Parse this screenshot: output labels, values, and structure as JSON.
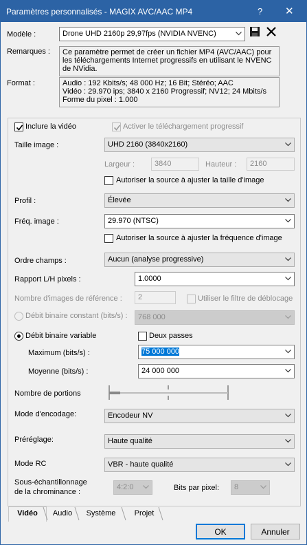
{
  "window": {
    "title": "Paramètres personnalisés - MAGIX AVC/AAC MP4",
    "help": "?",
    "close": "✕"
  },
  "header": {
    "model_label": "Modèle :",
    "model_value": "Drone UHD 2160p 29,97fps (NVIDIA NVENC)",
    "remarks_label": "Remarques :",
    "remarks_value": "Ce paramètre permet de créer un fichier MP4 (AVC/AAC) pour\nles téléchargements Internet progressifs en utilisant le NVENC\nde NVidia.",
    "format_label": "Format :",
    "format_value": "Audio : 192 Kbits/s; 48 000 Hz; 16 Bit; Stéréo; AAC\nVidéo : 29.970 ips; 3840 x 2160 Progressif; NV12; 24 Mbits/s\nForme du pixel : 1.000",
    "icons": {
      "save": "save-icon",
      "delete": "delete-icon"
    }
  },
  "video": {
    "include_video_label": "Inclure la vidéo",
    "include_video_checked": true,
    "progressive_download_label": "Activer le téléchargement progressif",
    "progressive_download_checked": true,
    "image_size_label": "Taille image :",
    "image_size_value": "UHD 2160 (3840x2160)",
    "width_label": "Largeur :",
    "width_value": "3840",
    "height_label": "Hauteur :",
    "height_value": "2160",
    "allow_resize_label": "Autoriser la source à ajuster la taille d'image",
    "profile_label": "Profil :",
    "profile_value": "Élevée",
    "frame_rate_label": "Fréq. image :",
    "frame_rate_value": "29.970 (NTSC)",
    "allow_frame_rate_label": "Autoriser la source à ajuster la fréquence d'image",
    "field_order_label": "Ordre champs :",
    "field_order_value": "Aucun (analyse progressive)",
    "pixel_aspect_label": "Rapport L/H pixels :",
    "pixel_aspect_value": "1.0000",
    "ref_frames_label": "Nombre d'images de référence :",
    "ref_frames_value": "2",
    "deblocking_label": "Utiliser le filtre de déblocage",
    "cbr_label": "Débit binaire constant (bits/s) :",
    "cbr_value": "768 000",
    "vbr_label": "Débit binaire variable",
    "two_pass_label": "Deux passes",
    "max_label": "Maximum (bits/s) :",
    "max_value": "75 000 000",
    "avg_label": "Moyenne (bits/s) :",
    "avg_value": "24 000 000",
    "slices_label": "Nombre de portions",
    "slices_level": 0,
    "encode_mode_label": "Mode d'encodage:",
    "encode_mode_value": "Encodeur NV",
    "preset_label": "Préréglage:",
    "preset_value": "Haute qualité",
    "rc_mode_label": "Mode RC",
    "rc_mode_value": "VBR - haute qualité",
    "chroma_label_line1": "Sous-échantillonnage",
    "chroma_label_line2": "de la chrominance :",
    "chroma_value": "4:2:0",
    "bits_per_pixel_label": "Bits par pixel:",
    "bits_per_pixel_value": "8"
  },
  "tabs": [
    {
      "label": "Vidéo",
      "active": true
    },
    {
      "label": "Audio",
      "active": false
    },
    {
      "label": "Système",
      "active": false
    },
    {
      "label": "Projet",
      "active": false
    }
  ],
  "buttons": {
    "ok": "OK",
    "cancel": "Annuler"
  },
  "colors": {
    "titlebar": "#2c63a5",
    "selection": "#0078d7",
    "window_bg": "#f0f0f0"
  }
}
